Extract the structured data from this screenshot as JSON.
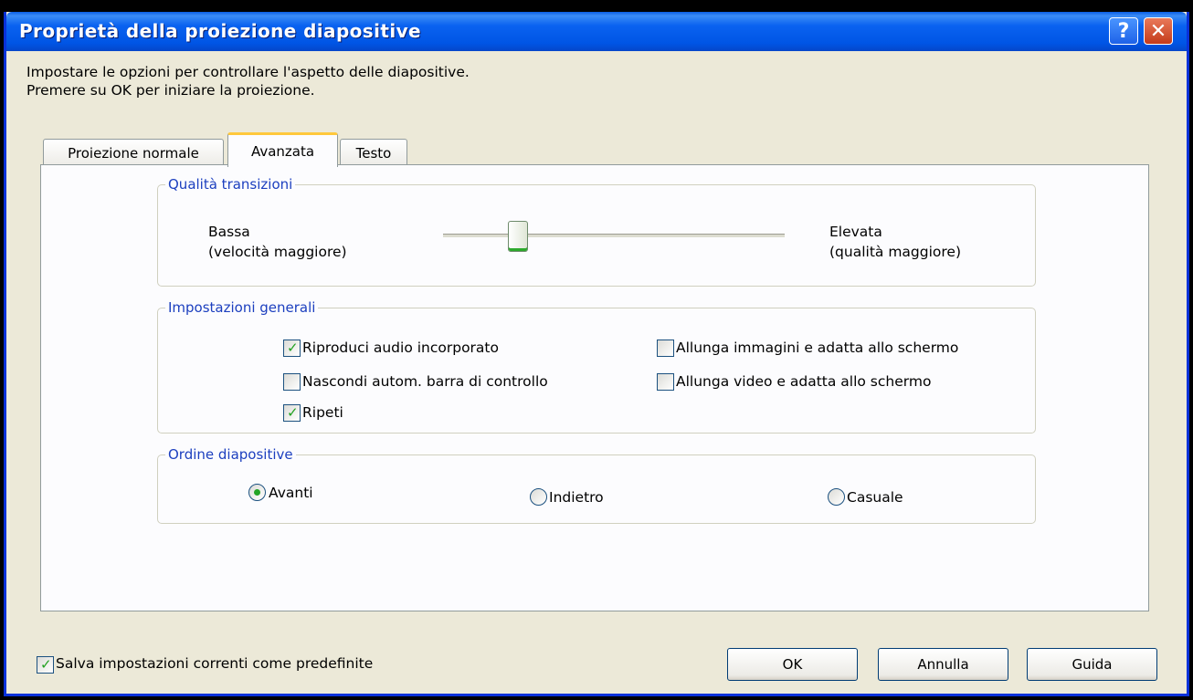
{
  "window": {
    "title": "Proprietà della proiezione diapositive"
  },
  "intro": {
    "line1": "Impostare le opzioni per controllare l'aspetto delle diapositive.",
    "line2": "Premere su OK per iniziare la proiezione."
  },
  "tabs": [
    {
      "label": "Proiezione normale",
      "selected": false
    },
    {
      "label": "Avanzata",
      "selected": true
    },
    {
      "label": "Testo",
      "selected": false
    }
  ],
  "transition_quality": {
    "legend": "Qualità transizioni",
    "low_label": "Bassa",
    "low_sub": "(velocità maggiore)",
    "high_label": "Elevata",
    "high_sub": "(qualità maggiore)",
    "slider_value_percent": 22
  },
  "general_settings": {
    "legend": "Impostazioni generali",
    "options": [
      {
        "label": "Riproduci audio incorporato",
        "checked": true
      },
      {
        "label": "Nascondi autom. barra di controllo",
        "checked": false
      },
      {
        "label": "Ripeti",
        "checked": true
      },
      {
        "label": "Allunga immagini e adatta allo schermo",
        "checked": false
      },
      {
        "label": "Allunga video e adatta allo schermo",
        "checked": false
      }
    ]
  },
  "slide_order": {
    "legend": "Ordine diapositive",
    "options": [
      {
        "label": "Avanti",
        "selected": true
      },
      {
        "label": "Indietro",
        "selected": false
      },
      {
        "label": "Casuale",
        "selected": false
      }
    ]
  },
  "footer": {
    "save_default": {
      "label": "Salva impostazioni correnti come predefinite",
      "checked": true
    },
    "ok": "OK",
    "cancel": "Annulla",
    "help": "Guida"
  },
  "icons": {
    "help": "question-mark-icon",
    "close": "close-x-icon"
  },
  "colors": {
    "titlebar": "#0055e5",
    "legend_text": "#1c3fbf",
    "check_mark": "#21a121",
    "tab_highlight": "#ffc83c"
  }
}
